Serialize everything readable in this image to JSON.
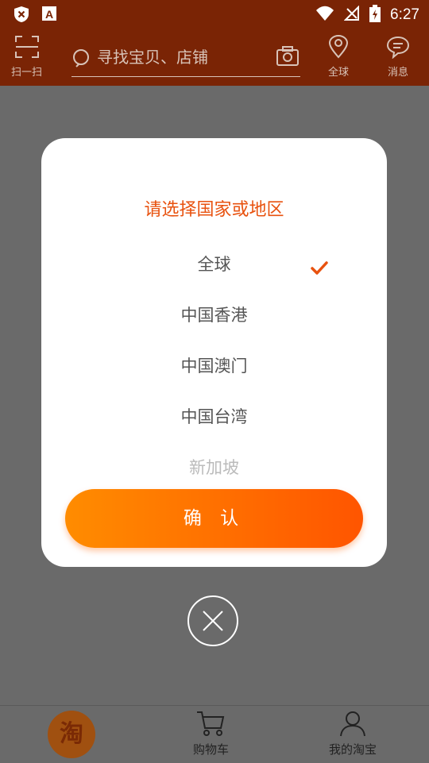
{
  "status_bar": {
    "time": "6:27"
  },
  "top_bar": {
    "scan_label": "扫一扫",
    "search_placeholder": "寻找宝贝、店铺",
    "location_label": "全球",
    "messages_label": "消息"
  },
  "dialog": {
    "title": "请选择国家或地区",
    "options": [
      {
        "label": "全球",
        "selected": true
      },
      {
        "label": "中国香港",
        "selected": false
      },
      {
        "label": "中国澳门",
        "selected": false
      },
      {
        "label": "中国台湾",
        "selected": false
      },
      {
        "label": "新加坡",
        "selected": false
      }
    ],
    "confirm_label": "确 认"
  },
  "bottom_nav": {
    "home_logo_text": "淘",
    "cart_label": "购物车",
    "my_label": "我的淘宝"
  },
  "colors": {
    "header_bg": "#7a2405",
    "accent": "#e8520f",
    "button_gradient_start": "#ff8c00",
    "button_gradient_end": "#ff5500"
  }
}
